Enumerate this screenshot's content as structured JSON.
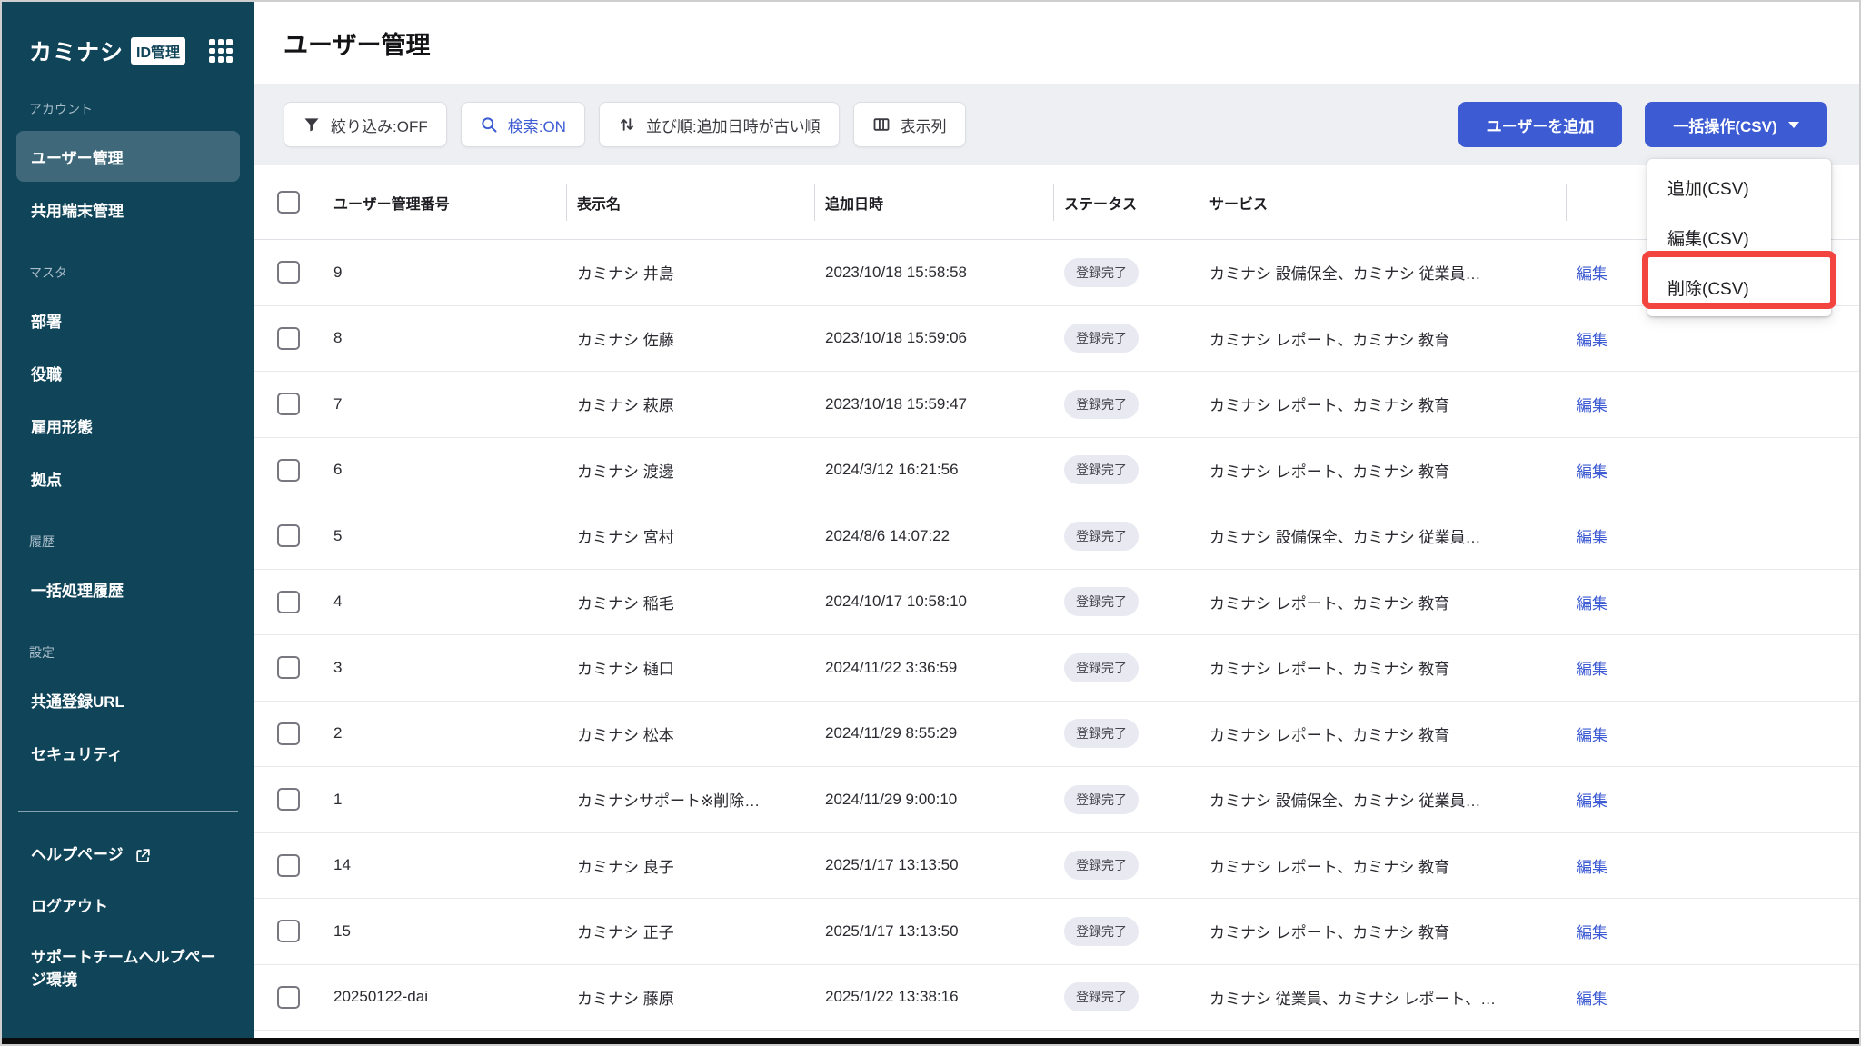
{
  "colors": {
    "sidebar-bg": "#0f4459",
    "band-bg": "#edeff3",
    "accent": "#3d5bd3",
    "badge-bg": "#e8e9f1",
    "row-line": "#e8e9ec",
    "annotation": "#f2453f"
  },
  "app": {
    "brand": "カミナシ",
    "brand_badge": "ID管理"
  },
  "sidebar": {
    "sections": [
      {
        "label": "アカウント",
        "items": [
          {
            "label": "ユーザー管理",
            "active": true
          },
          {
            "label": "共用端末管理"
          }
        ]
      },
      {
        "label": "マスタ",
        "items": [
          {
            "label": "部署"
          },
          {
            "label": "役職"
          },
          {
            "label": "雇用形態"
          },
          {
            "label": "拠点"
          }
        ]
      },
      {
        "label": "履歴",
        "items": [
          {
            "label": "一括処理履歴"
          }
        ]
      },
      {
        "label": "設定",
        "items": [
          {
            "label": "共通登録URL"
          },
          {
            "label": "セキュリティ"
          }
        ]
      }
    ],
    "footer_items": [
      {
        "label": "ヘルプページ",
        "external": true
      },
      {
        "label": "ログアウト"
      },
      {
        "label": "サポートチームヘルプページ環境"
      }
    ]
  },
  "header": {
    "title": "ユーザー管理"
  },
  "toolbar": {
    "filter_label": "絞り込み:OFF",
    "search_label": "検索:ON",
    "sort_label": "並び順:追加日時が古い順",
    "columns_label": "表示列",
    "add_user_label": "ユーザーを追加",
    "bulk_label": "一括操作(CSV)"
  },
  "menu": {
    "items": [
      "追加(CSV)",
      "編集(CSV)",
      "削除(CSV)"
    ],
    "highlighted_item": "削除(CSV)"
  },
  "table": {
    "headers": {
      "id": "ユーザー管理番号",
      "name": "表示名",
      "added": "追加日時",
      "status": "ステータス",
      "service": "サービス"
    },
    "edit_label": "編集",
    "status_done": "登録完了",
    "rows": [
      {
        "id": "9",
        "name": "カミナシ 井島",
        "added": "2023/10/18 15:58:58",
        "status": "登録完了",
        "services": "カミナシ 設備保全、カミナシ 従業員…"
      },
      {
        "id": "8",
        "name": "カミナシ 佐藤",
        "added": "2023/10/18 15:59:06",
        "status": "登録完了",
        "services": "カミナシ レポート、カミナシ 教育"
      },
      {
        "id": "7",
        "name": "カミナシ 萩原",
        "added": "2023/10/18 15:59:47",
        "status": "登録完了",
        "services": "カミナシ レポート、カミナシ 教育"
      },
      {
        "id": "6",
        "name": "カミナシ 渡邊",
        "added": "2024/3/12 16:21:56",
        "status": "登録完了",
        "services": "カミナシ レポート、カミナシ 教育"
      },
      {
        "id": "5",
        "name": "カミナシ 宮村",
        "added": "2024/8/6 14:07:22",
        "status": "登録完了",
        "services": "カミナシ 設備保全、カミナシ 従業員…"
      },
      {
        "id": "4",
        "name": "カミナシ 稲毛",
        "added": "2024/10/17 10:58:10",
        "status": "登録完了",
        "services": "カミナシ レポート、カミナシ 教育"
      },
      {
        "id": "3",
        "name": "カミナシ 樋口",
        "added": "2024/11/22 3:36:59",
        "status": "登録完了",
        "services": "カミナシ レポート、カミナシ 教育"
      },
      {
        "id": "2",
        "name": "カミナシ 松本",
        "added": "2024/11/29 8:55:29",
        "status": "登録完了",
        "services": "カミナシ レポート、カミナシ 教育"
      },
      {
        "id": "1",
        "name": "カミナシサポート※削除…",
        "added": "2024/11/29 9:00:10",
        "status": "登録完了",
        "services": "カミナシ 設備保全、カミナシ 従業員…"
      },
      {
        "id": "14",
        "name": "カミナシ 良子",
        "added": "2025/1/17 13:13:50",
        "status": "登録完了",
        "services": "カミナシ レポート、カミナシ 教育"
      },
      {
        "id": "15",
        "name": "カミナシ 正子",
        "added": "2025/1/17 13:13:50",
        "status": "登録完了",
        "services": "カミナシ レポート、カミナシ 教育"
      },
      {
        "id": "20250122-dai",
        "name": "カミナシ 藤原",
        "added": "2025/1/22 13:38:16",
        "status": "登録完了",
        "services": "カミナシ 従業員、カミナシ レポート、…"
      }
    ]
  }
}
